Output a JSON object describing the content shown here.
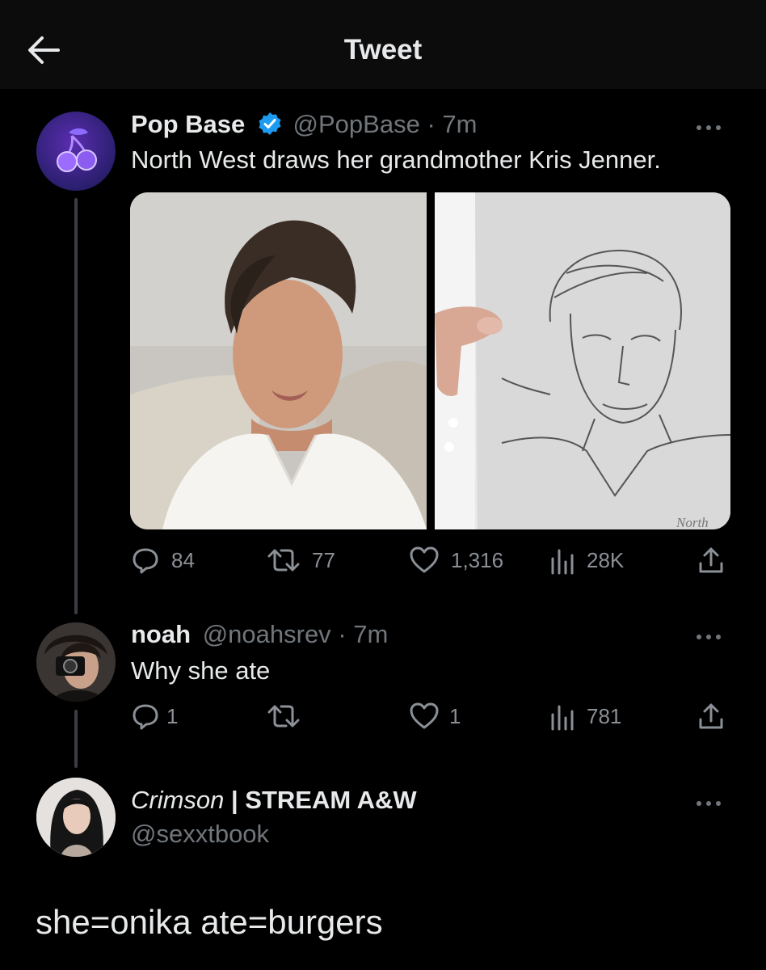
{
  "header": {
    "title": "Tweet"
  },
  "tweet": {
    "name": "Pop Base",
    "handle": "@PopBase",
    "time": "· 7m",
    "text": "North West draws her grandmother Kris Jenner.",
    "drawing_signature": "North",
    "actions": {
      "replies": "84",
      "retweets": "77",
      "likes": "1,316",
      "views": "28K"
    }
  },
  "reply1": {
    "name": "noah",
    "handle": "@noahsrev",
    "time": "· 7m",
    "text": "Why she ate",
    "actions": {
      "replies": "1",
      "retweets": "",
      "likes": "1",
      "views": "781"
    }
  },
  "reply2": {
    "name_italic": "Crimson",
    "name_rest": " | STREAM A&W",
    "handle": "@sexxtbook",
    "text": "she=onika ate=burgers"
  },
  "colors": {
    "background": "#000000",
    "muted": "#71767b",
    "verified": "#1d9bf0",
    "avatar_gradient": "#6a2fbf"
  }
}
